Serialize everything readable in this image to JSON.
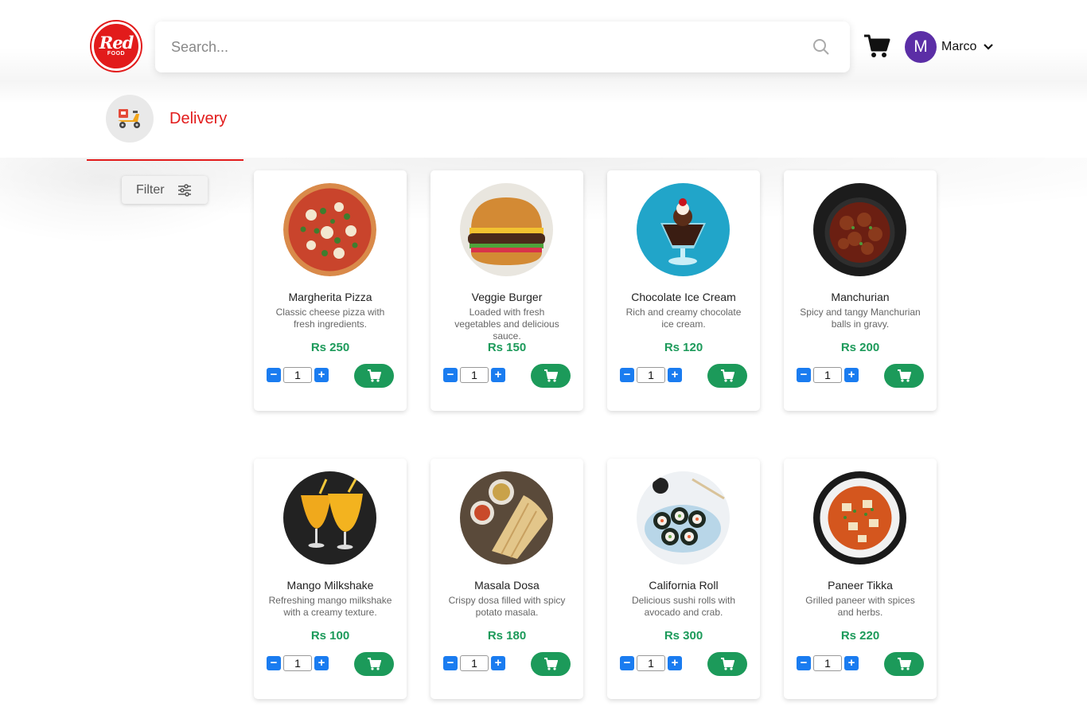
{
  "header": {
    "logo_text": "Red",
    "logo_sub": "FOOD",
    "search_placeholder": "Search...",
    "user_initial": "M",
    "user_name": "Marco"
  },
  "tabs": [
    {
      "label": "Delivery",
      "active": true
    }
  ],
  "filter": {
    "label": "Filter"
  },
  "colors": {
    "brand": "#e21b1b",
    "price": "#1c9a5a",
    "stepper": "#1a7cf0",
    "avatar": "#5b2ea6"
  },
  "items": [
    {
      "name": "Margherita Pizza",
      "description": "Classic cheese pizza with fresh ingredients.",
      "price": "Rs 250",
      "qty": "1"
    },
    {
      "name": "Veggie Burger",
      "description": "Loaded with fresh vegetables and delicious sauce.",
      "price": "Rs 150",
      "qty": "1"
    },
    {
      "name": "Chocolate Ice Cream",
      "description": "Rich and creamy chocolate ice cream.",
      "price": "Rs 120",
      "qty": "1"
    },
    {
      "name": "Manchurian",
      "description": "Spicy and tangy Manchurian balls in gravy.",
      "price": "Rs 200",
      "qty": "1"
    },
    {
      "name": "Mango Milkshake",
      "description": "Refreshing mango milkshake with a creamy texture.",
      "price": "Rs 100",
      "qty": "1"
    },
    {
      "name": "Masala Dosa",
      "description": "Crispy dosa filled with spicy potato masala.",
      "price": "Rs 180",
      "qty": "1"
    },
    {
      "name": "California Roll",
      "description": "Delicious sushi rolls with avocado and crab.",
      "price": "Rs 300",
      "qty": "1"
    },
    {
      "name": "Paneer Tikka",
      "description": "Grilled paneer with spices and herbs.",
      "price": "Rs 220",
      "qty": "1"
    }
  ]
}
